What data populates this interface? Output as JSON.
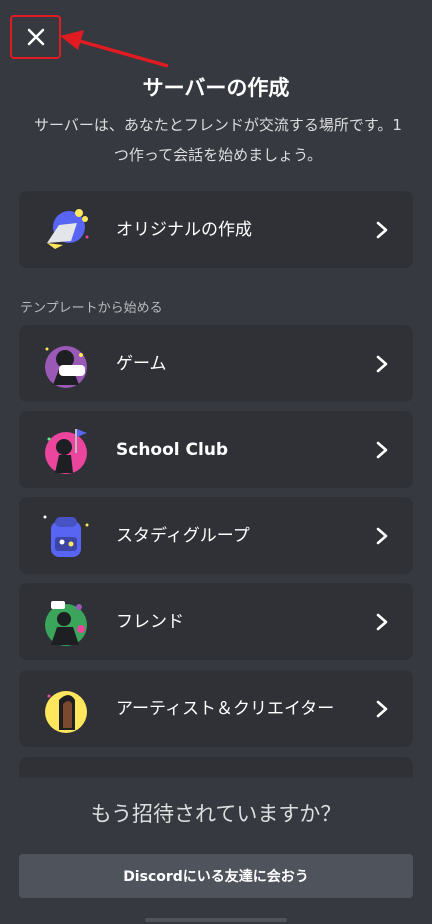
{
  "header": {
    "title": "サーバーの作成",
    "subtitle": "サーバーは、あなたとフレンドが交流する場所です。1つ作って会話を始めましょう。"
  },
  "create_own": {
    "label": "オリジナルの作成"
  },
  "templates": {
    "section_label": "テンプレートから始める",
    "items": [
      {
        "label": "ゲーム"
      },
      {
        "label": "School Club"
      },
      {
        "label": "スタディグループ"
      },
      {
        "label": "フレンド"
      },
      {
        "label": "アーティスト＆クリエイター"
      }
    ]
  },
  "invite": {
    "title": "もう招待されていますか？",
    "button_label": "Discordにいる友達に会おう"
  },
  "colors": {
    "background": "#36393f",
    "card": "#2f3136",
    "annotation_red": "#e11b22"
  }
}
